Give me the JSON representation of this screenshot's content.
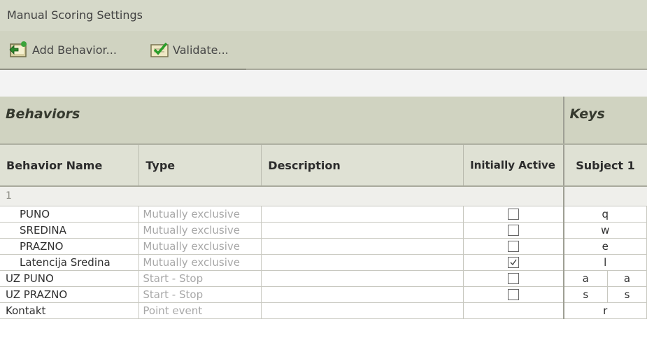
{
  "window": {
    "title": "Manual Scoring Settings"
  },
  "toolbar": {
    "add_behavior_label": "Add Behavior...",
    "validate_label": "Validate..."
  },
  "sections": {
    "behaviors": "Behaviors",
    "keys": "Keys"
  },
  "columns": {
    "name": "Behavior Name",
    "type": "Type",
    "description": "Description",
    "initially_active": "Initially Active",
    "subject": "Subject 1"
  },
  "group": {
    "label": "1"
  },
  "rows": [
    {
      "name": "PUNO",
      "type": "Mutually exclusive",
      "description": "",
      "initially_active": false,
      "keys": [
        "q"
      ]
    },
    {
      "name": "SREDINA",
      "type": "Mutually exclusive",
      "description": "",
      "initially_active": false,
      "keys": [
        "w"
      ]
    },
    {
      "name": "PRAZNO",
      "type": "Mutually exclusive",
      "description": "",
      "initially_active": false,
      "keys": [
        "e"
      ]
    },
    {
      "name": "Latencija Sredina",
      "type": "Mutually exclusive",
      "description": "",
      "initially_active": true,
      "keys": [
        "l"
      ]
    },
    {
      "name": "UZ PUNO",
      "type": "Start - Stop",
      "description": "",
      "initially_active": false,
      "keys": [
        "a",
        "a"
      ]
    },
    {
      "name": "UZ PRAZNO",
      "type": "Start - Stop",
      "description": "",
      "initially_active": false,
      "keys": [
        "s",
        "s"
      ]
    },
    {
      "name": "Kontakt",
      "type": "Point event",
      "description": "",
      "initially_active": null,
      "keys": [
        "r"
      ]
    }
  ],
  "colors": {
    "header_bg": "#d0d3c1",
    "column_header_bg": "#dfe1d4",
    "muted_text": "#a8a8a8"
  }
}
